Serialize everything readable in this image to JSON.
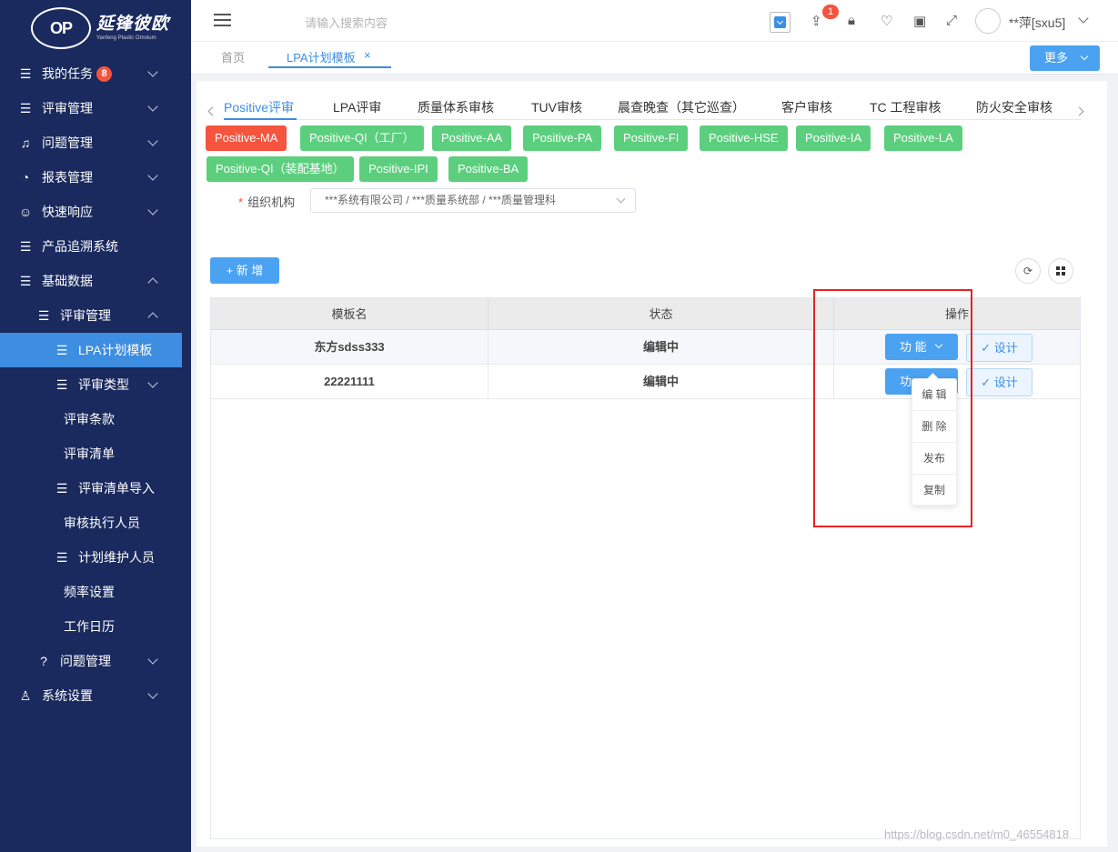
{
  "logo": {
    "mark": "OP",
    "cn": "延锋彼欧",
    "en": "Yanfeng Plastic Omnium"
  },
  "sidebar": {
    "items": [
      {
        "label": "我的任务",
        "badge": "8",
        "icon": "list-icon"
      },
      {
        "label": "评审管理",
        "icon": "list-icon"
      },
      {
        "label": "问题管理",
        "icon": "bell-icon"
      },
      {
        "label": "报表管理",
        "icon": "pie-chart-icon"
      },
      {
        "label": "快速响应",
        "icon": "user-group-icon"
      },
      {
        "label": "产品追溯系统",
        "icon": "list-icon"
      },
      {
        "label": "基础数据",
        "icon": "list-icon"
      },
      {
        "label": "评审管理",
        "icon": "list-icon"
      },
      {
        "label": "LPA计划模板",
        "icon": "list-icon"
      },
      {
        "label": "评审类型",
        "icon": "list-icon"
      },
      {
        "label": "评审条款"
      },
      {
        "label": "评审清单"
      },
      {
        "label": "评审清单导入",
        "icon": "list-icon"
      },
      {
        "label": "审核执行人员"
      },
      {
        "label": "计划维护人员",
        "icon": "list-icon"
      },
      {
        "label": "频率设置"
      },
      {
        "label": "工作日历"
      },
      {
        "label": "问题管理",
        "icon": "question-circle-icon"
      },
      {
        "label": "系统设置",
        "icon": "person-icon"
      }
    ]
  },
  "header": {
    "search_placeholder": "请输入搜索内容",
    "notif_count": "1",
    "username": "**萍[sxu5]"
  },
  "page_tabs": {
    "home": "首页",
    "current": "LPA计划模板",
    "more": "更多"
  },
  "audit_tabs": [
    "Positive评审",
    "LPA评审",
    "质量体系审核",
    "TUV审核",
    "晨查晚查（其它巡查）",
    "客户审核",
    "TC 工程审核",
    "防火安全审核"
  ],
  "tags": [
    "Positive-MA",
    "Positive-QI（工厂）",
    "Positive-AA",
    "Positive-PA",
    "Positive-FI",
    "Positive-HSE",
    "Positive-IA",
    "Positive-LA",
    "Positive-QI（装配基地）",
    "Positive-IPI",
    "Positive-BA"
  ],
  "form": {
    "org_label": "组织机构",
    "org_value": "***系统有限公司 / ***质量系统部 / ***质量管理科"
  },
  "toolbar": {
    "add_label": "+ 新 增",
    "refresh_icon": "⟳"
  },
  "table": {
    "headers": [
      "模板名",
      "状态",
      "操作"
    ],
    "rows": [
      {
        "name": "东方sdss333",
        "status": "编辑中"
      },
      {
        "name": "22221111",
        "status": "编辑中"
      }
    ],
    "fn_label": "功 能",
    "fn_label_short": "功",
    "design_label": "✓ 设计"
  },
  "dropdown": [
    "编 辑",
    "删 除",
    "发布",
    "复制"
  ],
  "watermark": "https://blog.csdn.net/m0_46554818",
  "colors": {
    "sidebar": "#1a2a5e",
    "accent": "#3d8de0",
    "tag_green": "#5ccf7e",
    "tag_red": "#f5543f",
    "highlight": "#e52424"
  }
}
